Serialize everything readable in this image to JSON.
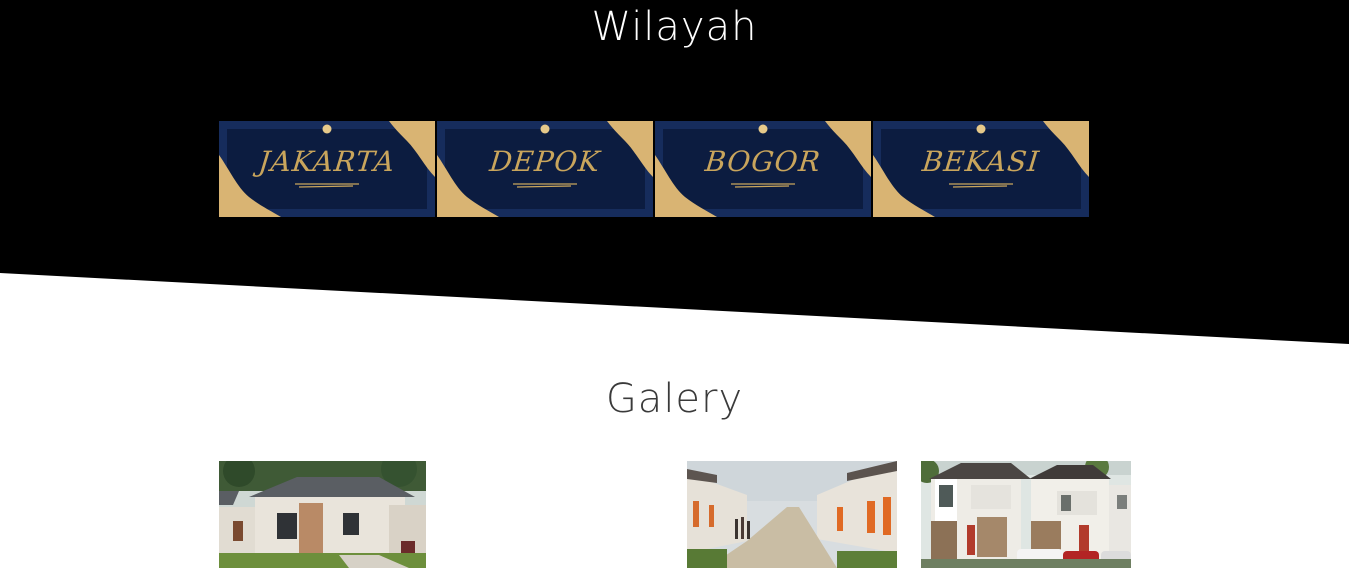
{
  "sections": {
    "wilayah_title": "Wilayah",
    "galery_title": "Galery"
  },
  "regions": [
    {
      "label": "JAKARTA",
      "icon": "jakarta-card-image"
    },
    {
      "label": "DEPOK",
      "icon": "depok-card-image"
    },
    {
      "label": "BOGOR",
      "icon": "bogor-card-image"
    },
    {
      "label": "BEKASI",
      "icon": "bekasi-card-image"
    }
  ],
  "gallery": [
    {
      "icon": "house-photo"
    },
    {
      "icon": "housing-street-photo"
    },
    {
      "icon": "two-storey-house-photo"
    }
  ],
  "colors": {
    "hero_bg": "#000000",
    "page_bg": "#ffffff",
    "card_navy": "#162c5c",
    "card_gold": "#c9a55c"
  }
}
